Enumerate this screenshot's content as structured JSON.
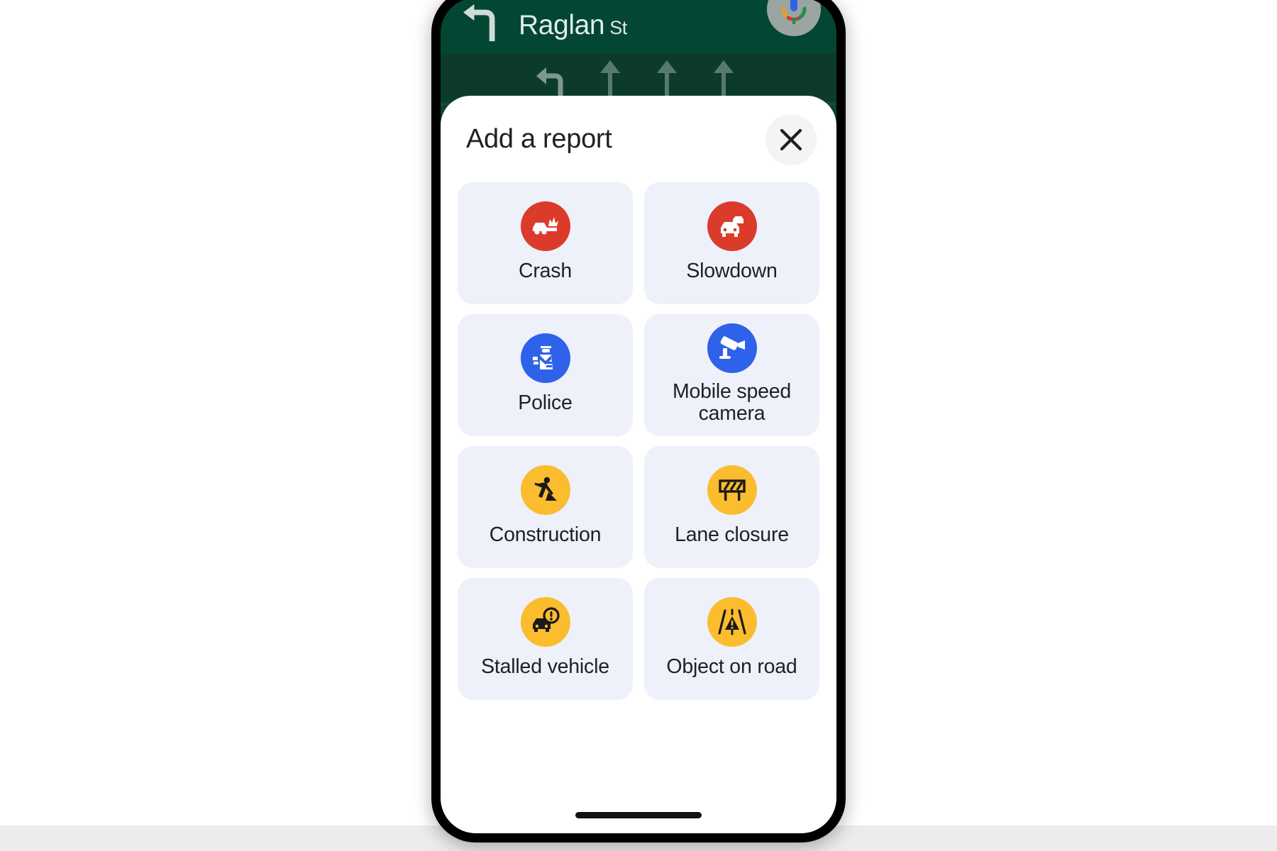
{
  "navigation": {
    "street_name": "Raglan",
    "street_suffix": "St",
    "turn_icon": "turn-left-arrow-icon",
    "assistant_icon": "google-assistant-mic-icon",
    "lane_guidance": [
      "lane-turn-left-icon",
      "lane-straight-icon",
      "lane-straight-icon",
      "lane-straight-icon"
    ],
    "nav_bar_color": "#044634",
    "map_color": "#0f4133"
  },
  "sheet": {
    "title": "Add a report",
    "close_label": "×",
    "close_icon": "close-icon",
    "card_bg": "#eef1fa"
  },
  "report_options": [
    {
      "label": "Crash",
      "icon": "crash-icon",
      "color": "#db3b2b",
      "two_line": false
    },
    {
      "label": "Slowdown",
      "icon": "slowdown-icon",
      "color": "#db3b2b",
      "two_line": false
    },
    {
      "label": "Police",
      "icon": "police-icon",
      "color": "#2f62ea",
      "two_line": false
    },
    {
      "label": "Mobile speed camera",
      "icon": "speed-camera-icon",
      "color": "#2f62ea",
      "two_line": true
    },
    {
      "label": "Construction",
      "icon": "construction-icon",
      "color": "#fbbc2e",
      "two_line": false
    },
    {
      "label": "Lane closure",
      "icon": "lane-closure-icon",
      "color": "#fbbc2e",
      "two_line": false
    },
    {
      "label": "Stalled vehicle",
      "icon": "stalled-vehicle-icon",
      "color": "#fbbc2e",
      "two_line": false
    },
    {
      "label": "Object on road",
      "icon": "object-on-road-icon",
      "color": "#fbbc2e",
      "two_line": false
    }
  ],
  "system": {
    "home_indicator": "home-indicator"
  }
}
